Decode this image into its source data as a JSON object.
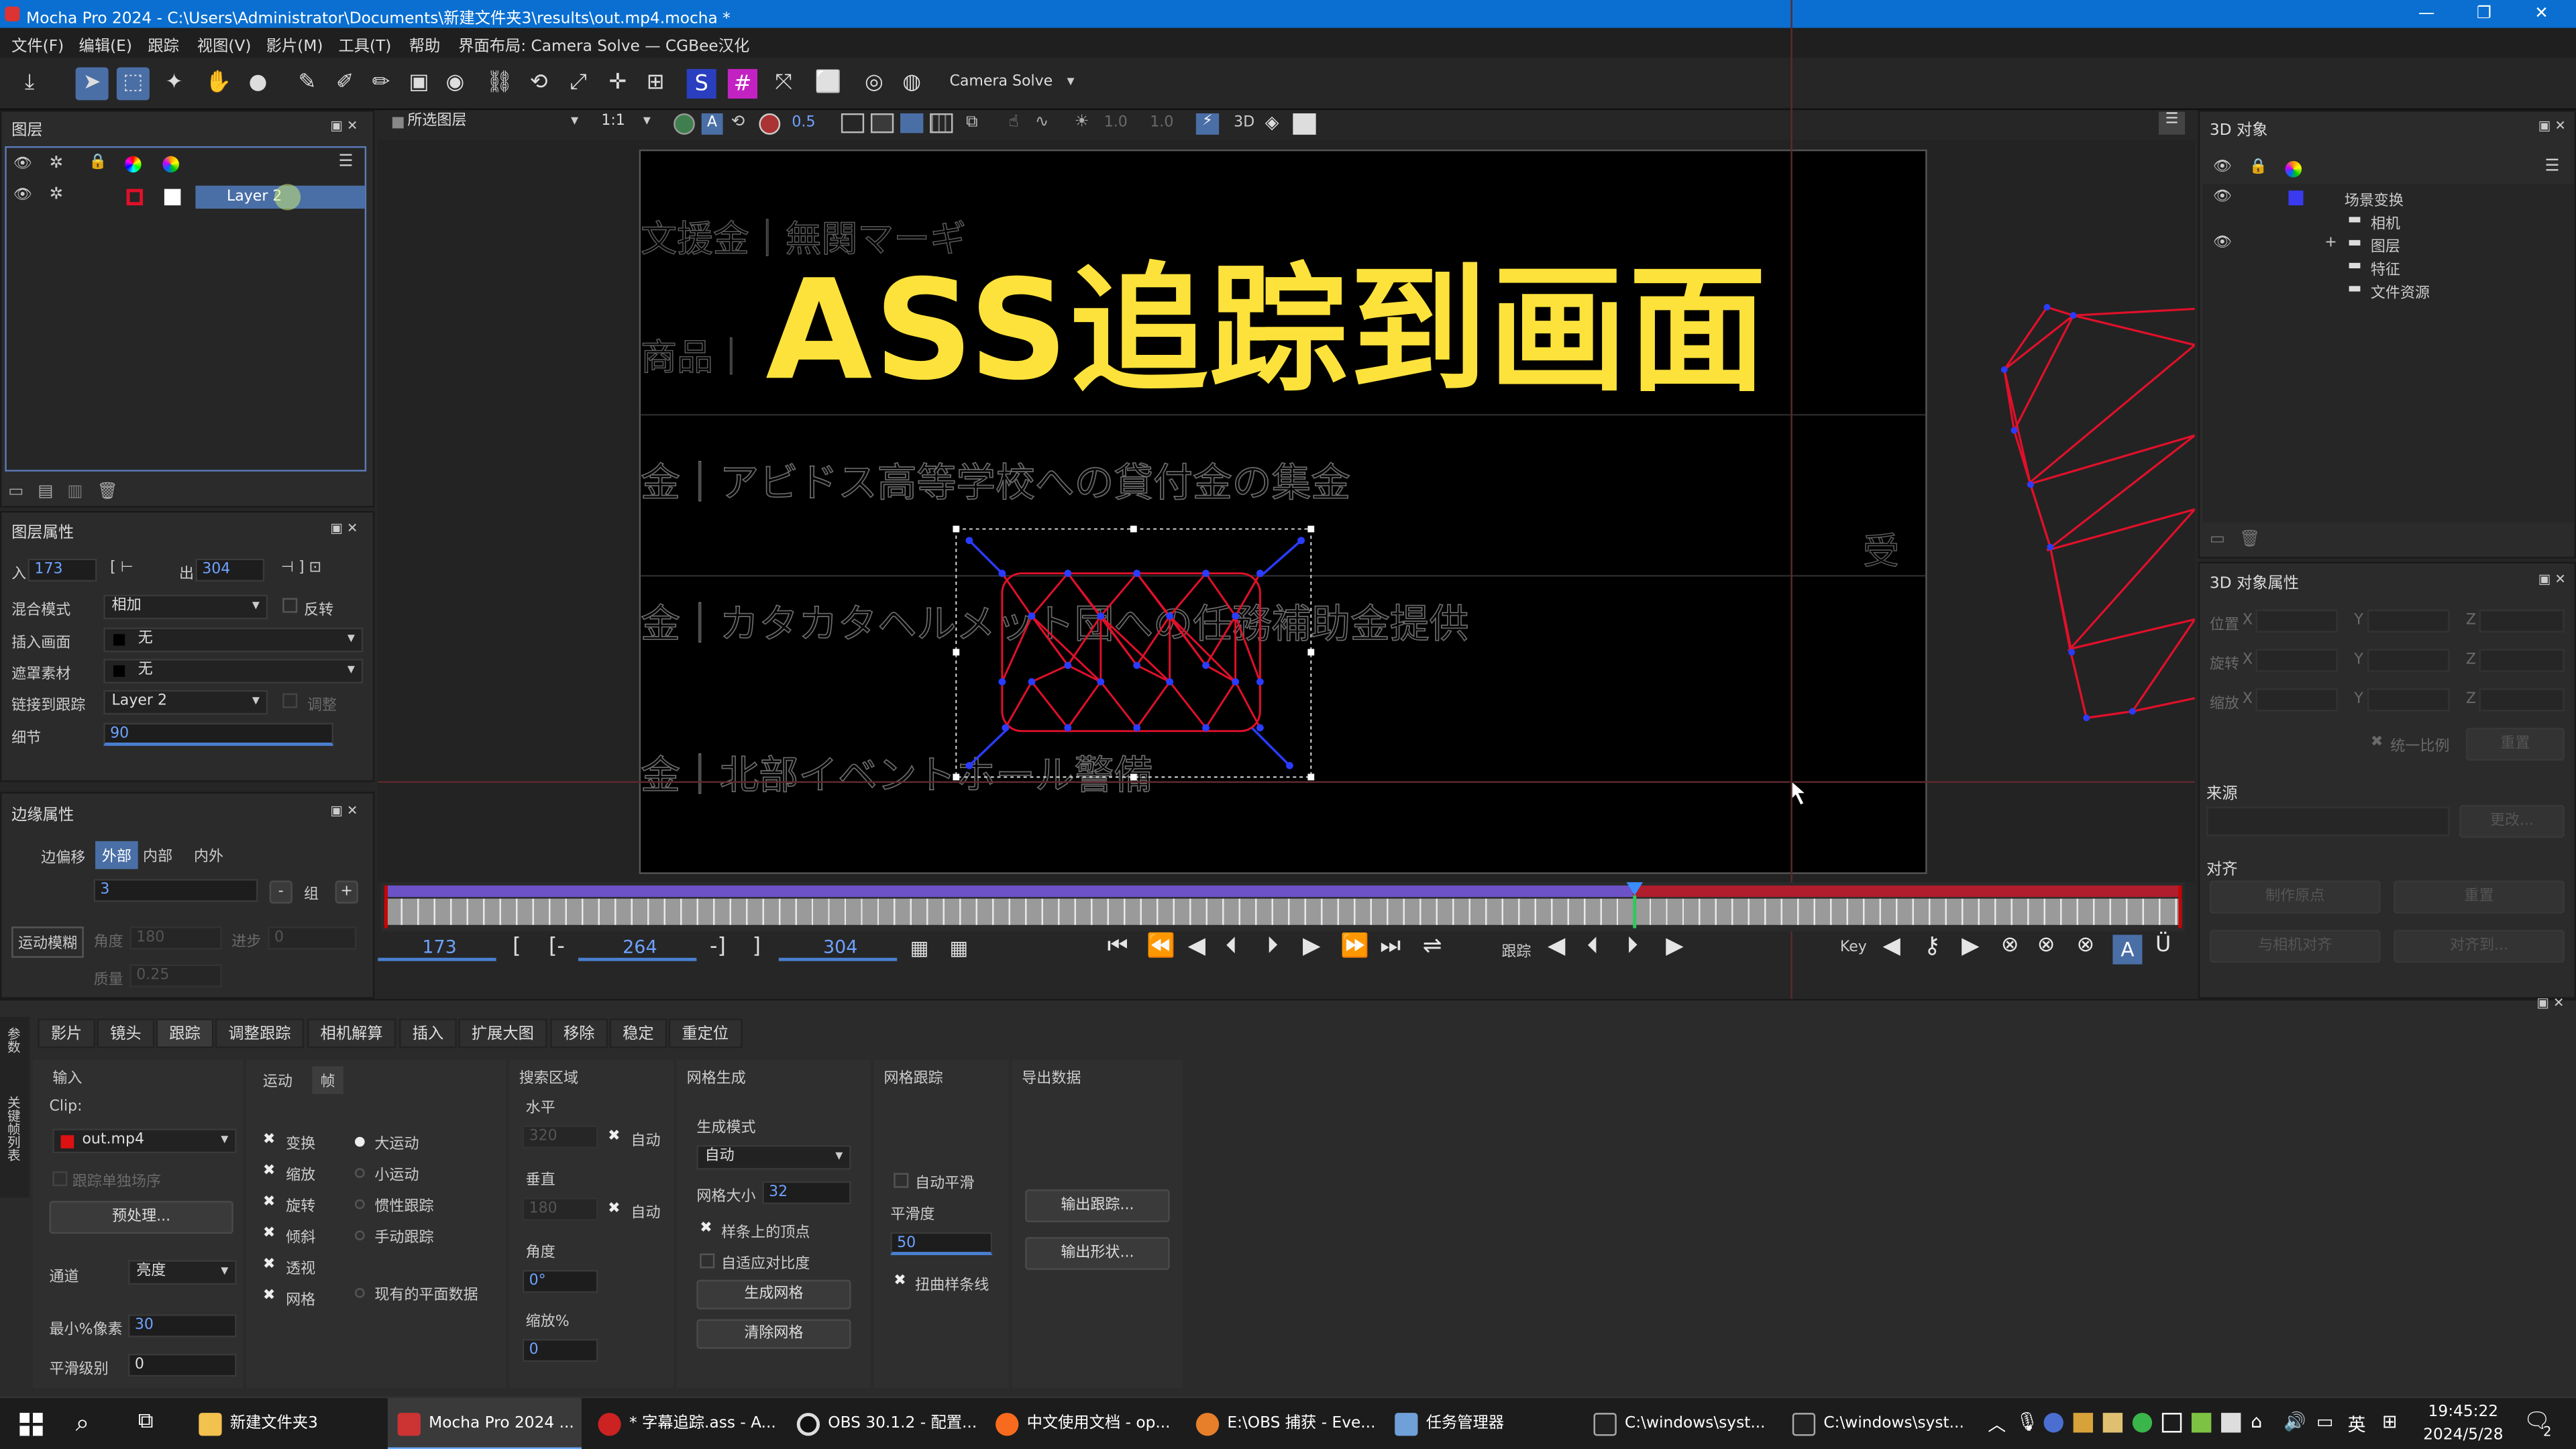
{
  "window": {
    "title": "Mocha Pro 2024 - C:\\Users\\Administrator\\Documents\\新建文件夹3\\results\\out.mp4.mocha *"
  },
  "menu": [
    "文件(F)",
    "编辑(E)",
    "跟踪",
    "视图(V)",
    "影片(M)",
    "工具(T)",
    "帮助",
    "界面布局: Camera Solve — CGBee汉化"
  ],
  "toolbar": {
    "workspace": "Camera Solve"
  },
  "layers_panel": {
    "title": "图层",
    "layer_name": "Layer 2"
  },
  "viewer_bar": {
    "source": "所选图层",
    "zoom": "1:1",
    "opacity": "0.5",
    "v1": "1.0",
    "v2": "1.0",
    "mode3d": "3D"
  },
  "overlay": {
    "headline": "ASS追踪到画面"
  },
  "bg_text": [
    "文援金｜無関マーギ",
    "商品｜",
    "金｜アビドス高等学校への貸付金の集金",
    "金｜カタカタヘルメット団への任務補助金提供",
    "金｜北部イベントホール警備",
    "受"
  ],
  "layer_props": {
    "title": "图层属性",
    "in_label": "入",
    "in": "173",
    "out_label": "出",
    "out": "304",
    "blend_label": "混合模式",
    "blend": "相加",
    "invert": "反转",
    "insert_label": "插入画面",
    "insert": "无",
    "matte_label": "遮罩素材",
    "matte": "无",
    "link_label": "链接到跟踪",
    "link": "Layer 2",
    "adjust": "调整",
    "detail_label": "细节",
    "detail": "90"
  },
  "edge_props": {
    "title": "边缘属性",
    "offset_label": "边偏移",
    "tabs": [
      "外部",
      "内部",
      "内外"
    ],
    "offset": "3",
    "group": "组",
    "motion_blur": "运动模糊",
    "angle_label": "角度",
    "angle": "180",
    "phase_label": "进步",
    "phase": "0",
    "quality_label": "质量",
    "quality": "0.25"
  },
  "timeline": {
    "current": "173",
    "in": "264",
    "out": "304",
    "track_label": "跟踪",
    "key_label": "Key"
  },
  "objects3d": {
    "title": "3D 对象",
    "tree": [
      "场景变换",
      "相机",
      "图层",
      "特征",
      "文件资源"
    ]
  },
  "props3d": {
    "title": "3D 对象属性",
    "rows": [
      "位置",
      "旋转",
      "缩放"
    ],
    "axes": [
      "X",
      "Y",
      "Z"
    ],
    "uniform": "统一比例",
    "reset": "重置",
    "source": "来源",
    "change": "更改...",
    "align": "对齐",
    "set_origin": "制作原点",
    "reset2": "重置",
    "align_cam": "与相机对齐",
    "align_edit": "对齐到..."
  },
  "params": {
    "tabs": [
      "影片",
      "镜头",
      "跟踪",
      "调整跟踪",
      "相机解算",
      "插入",
      "扩展大图",
      "移除",
      "稳定",
      "重定位"
    ],
    "side": [
      "参数",
      "关键帧列表"
    ],
    "input": "输入",
    "clip_label": "Clip:",
    "clip": "out.mp4",
    "track_sep": "跟踪单独场序",
    "preprocess": "预处理...",
    "channel_label": "通道",
    "channel": "亮度",
    "min_px_label": "最小%像素",
    "min_px": "30",
    "smooth_label": "平滑级别",
    "smooth": "0",
    "motion_tabs": [
      "运动",
      "帧"
    ],
    "motion": [
      "变换",
      "缩放",
      "旋转",
      "倾斜",
      "透视",
      "网格"
    ],
    "motion_type": [
      "大运动",
      "小运动",
      "惯性跟踪",
      "手动跟踪",
      "现有的平面数据"
    ],
    "search": "搜索区域",
    "horiz": "水平",
    "horiz_val": "320",
    "auto": "自动",
    "vert": "垂直",
    "vert_val": "180",
    "angle": "角度",
    "angle_val": "0°",
    "zoom": "缩放%",
    "zoom_val": "0",
    "mesh_gen": "网格生成",
    "gen_mode": "生成模式",
    "gen_val": "自动",
    "mesh_size": "网格大小",
    "mesh_size_val": "32",
    "spline_vert": "样条上的顶点",
    "adapt_contrast": "自适应对比度",
    "gen_mesh": "生成网格",
    "clear_mesh": "清除网格",
    "mesh_track": "网格跟踪",
    "auto_smooth": "自动平滑",
    "smoothness": "平滑度",
    "smoothness_val": "50",
    "warp_spline": "扭曲样条线",
    "export": "导出数据",
    "export_track": "输出跟踪...",
    "export_shape": "输出形状..."
  },
  "taskbar": {
    "items": [
      "新建文件夹3",
      "Mocha Pro 2024 ...",
      "* 字幕追踪.ass - A...",
      "OBS 30.1.2 - 配置...",
      "中文使用文档 - op...",
      "E:\\OBS 捕获 - Eve...",
      "任务管理器",
      "C:\\windows\\syst...",
      "C:\\windows\\syst..."
    ],
    "ime": "英",
    "time": "19:45:22",
    "date": "2024/5/28",
    "notif": "2"
  },
  "colors": {
    "accent": "#4a6fa6",
    "title_blue": "#0a6fd1",
    "headline": "#fde23b",
    "mesh": "#e0102a",
    "points": "#2a3cff"
  }
}
